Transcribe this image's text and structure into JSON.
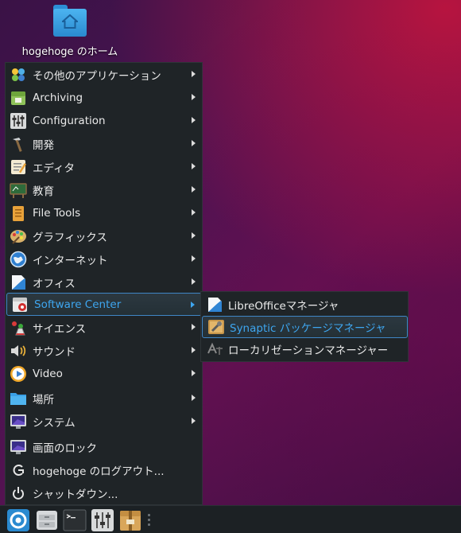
{
  "desktop": {
    "home_icon_label": "hogehoge のホーム"
  },
  "menu": {
    "items": [
      {
        "label": "その他のアプリケーション",
        "icon": "apps-icon"
      },
      {
        "label": "Archiving",
        "icon": "archive-icon"
      },
      {
        "label": "Configuration",
        "icon": "sliders-icon"
      },
      {
        "label": "開発",
        "icon": "hammer-icon"
      },
      {
        "label": "エディタ",
        "icon": "editor-icon"
      },
      {
        "label": "教育",
        "icon": "education-icon"
      },
      {
        "label": "File Tools",
        "icon": "file-tools-icon"
      },
      {
        "label": "グラフィックス",
        "icon": "palette-icon"
      },
      {
        "label": "インターネット",
        "icon": "globe-icon"
      },
      {
        "label": "オフィス",
        "icon": "office-icon"
      },
      {
        "label": "Software Center",
        "icon": "software-center-icon"
      },
      {
        "label": "サイエンス",
        "icon": "science-icon"
      },
      {
        "label": "サウンド",
        "icon": "speaker-icon"
      },
      {
        "label": "Video",
        "icon": "video-icon"
      },
      {
        "label": "場所",
        "icon": "folder-icon"
      },
      {
        "label": "システム",
        "icon": "monitor-icon"
      }
    ],
    "actions": [
      {
        "label": "画面のロック",
        "icon": "lock-screen-icon"
      },
      {
        "label": "hogehoge のログアウト...",
        "icon": "logout-icon"
      },
      {
        "label": "シャットダウン...",
        "icon": "power-icon"
      }
    ],
    "active_item": "Software Center"
  },
  "submenu": {
    "items": [
      {
        "label": "LibreOfficeマネージャ",
        "icon": "libreoffice-icon"
      },
      {
        "label": "Synaptic パッケージマネージャ",
        "icon": "synaptic-icon"
      },
      {
        "label": "ローカリゼーションマネージャー",
        "icon": "localization-icon"
      }
    ]
  },
  "taskbar": {
    "launchers": [
      "start-menu-icon",
      "file-manager-icon",
      "terminal-icon",
      "settings-icon",
      "archive-manager-icon"
    ]
  },
  "colors": {
    "highlight_text": "#3ea6f0",
    "highlight_border": "#3f86c6",
    "menu_bg": "#1f2427"
  }
}
